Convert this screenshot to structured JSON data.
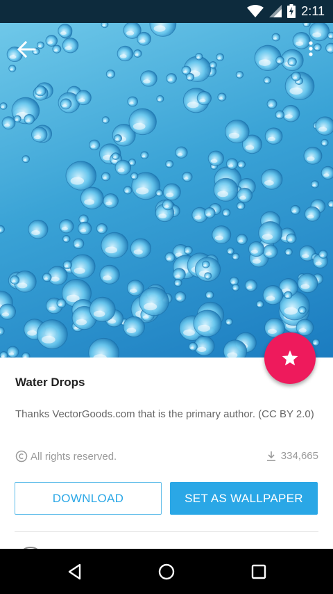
{
  "status_bar": {
    "time": "2:11",
    "battery_icon": "battery-charging-icon",
    "wifi_icon": "wifi-icon",
    "signal_icon": "cell-signal-icon"
  },
  "toolbar": {
    "back_icon": "arrow-back-icon",
    "overflow_icon": "more-vert-icon"
  },
  "wallpaper": {
    "image": "water-drops-wallpaper",
    "fab_icon": "star-icon",
    "fab_color": "#ee1a5c"
  },
  "details": {
    "title": "Water Drops",
    "description": "Thanks VectorGoods.com that is the primary author. (CC BY 2.0)",
    "license": "All rights reserved.",
    "download_count": "334,665"
  },
  "actions": {
    "download_label": "DOWNLOAD",
    "set_wallpaper_label": "SET AS WALLPAPER",
    "accent": "#2aa7e6"
  },
  "nav_bar": {
    "back_icon": "nav-back-icon",
    "home_icon": "nav-home-icon",
    "recents_icon": "nav-recents-icon"
  }
}
